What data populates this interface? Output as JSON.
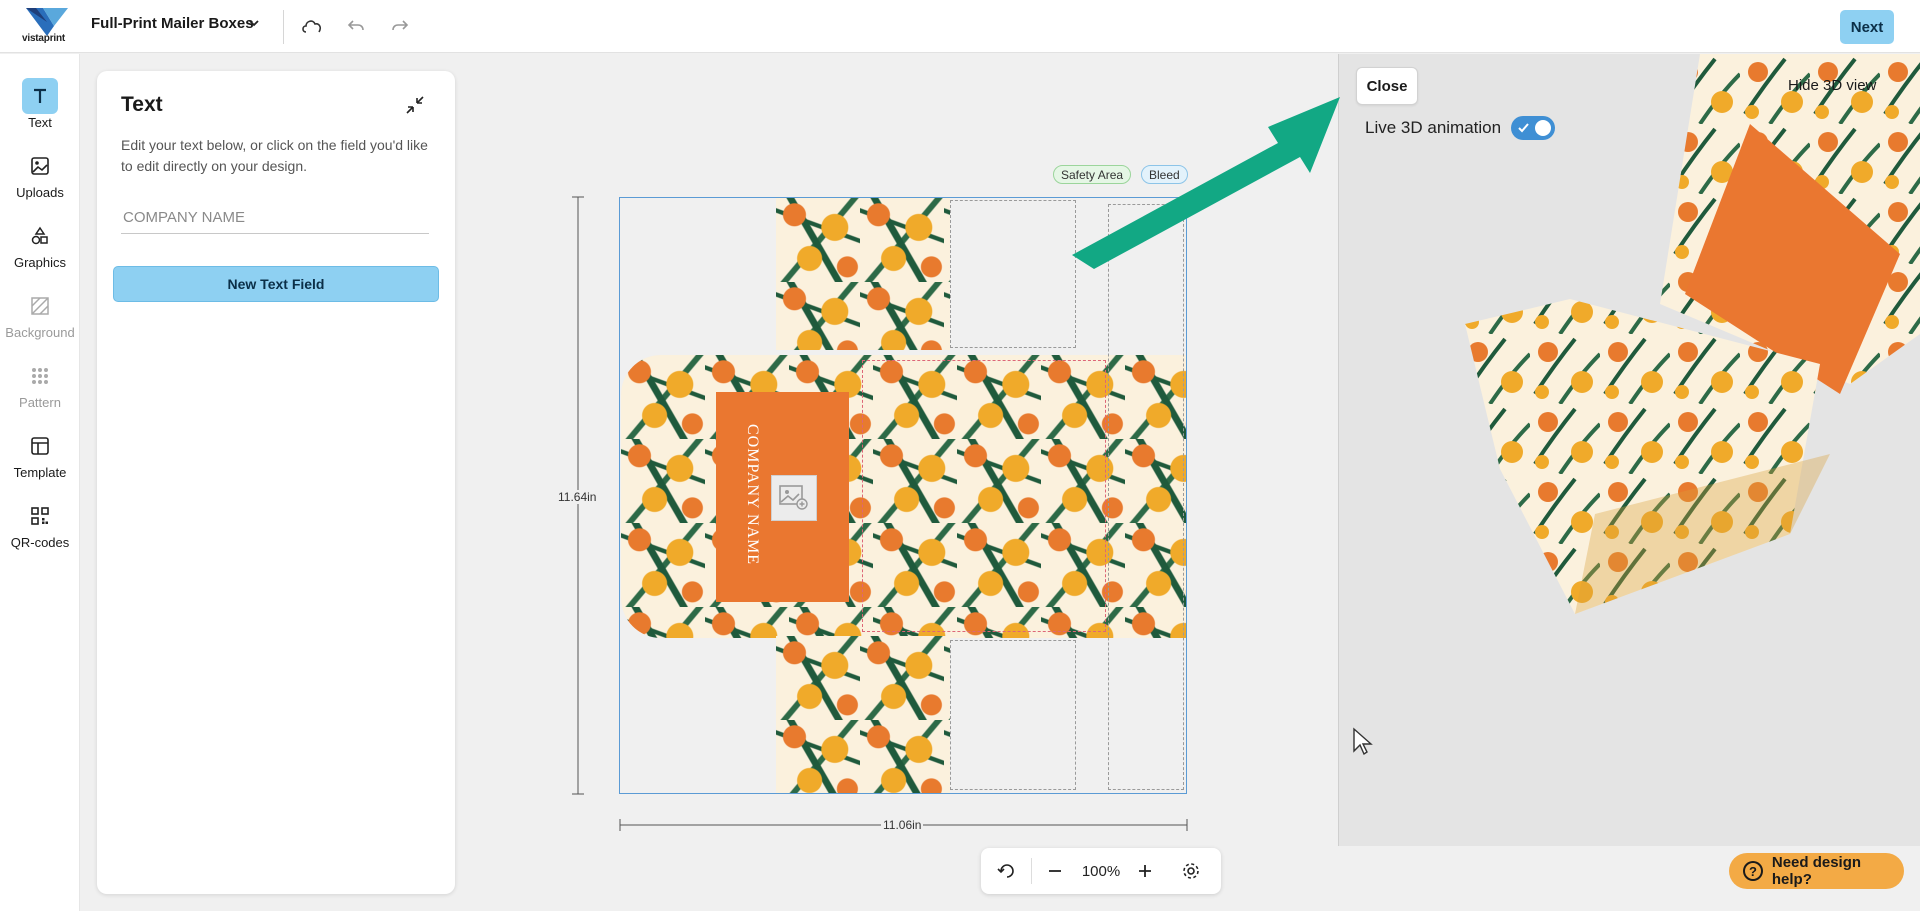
{
  "app": {
    "brand": "vistaprint",
    "product_title": "Full-Print Mailer Boxes",
    "next_label": "Next"
  },
  "rail": {
    "items": [
      {
        "label": "Text",
        "icon": "text-icon",
        "state": "active"
      },
      {
        "label": "Uploads",
        "icon": "image-icon",
        "state": "enabled"
      },
      {
        "label": "Graphics",
        "icon": "shapes-icon",
        "state": "enabled"
      },
      {
        "label": "Background",
        "icon": "background-icon",
        "state": "disabled"
      },
      {
        "label": "Pattern",
        "icon": "pattern-icon",
        "state": "disabled"
      },
      {
        "label": "Template",
        "icon": "template-icon",
        "state": "enabled"
      },
      {
        "label": "QR-codes",
        "icon": "qr-icon",
        "state": "enabled"
      }
    ]
  },
  "text_panel": {
    "title": "Text",
    "description": "Edit your text below, or click on the field you'd like to edit directly on your design.",
    "input_placeholder": "COMPANY NAME",
    "input_value": "",
    "new_field_label": "New Text Field"
  },
  "canvas": {
    "safety_chip": "Safety Area",
    "bleed_chip": "Bleed",
    "height_label": "11.64in",
    "width_label": "11.06in",
    "design_text": "COMPANY NAME",
    "zoom": "100%"
  },
  "view3d": {
    "close_label": "Close",
    "live_label": "Live 3D animation",
    "live_enabled": true,
    "hide_label": "Hide 3D view"
  },
  "help": {
    "label": "Need design help?",
    "icon_glyph": "?"
  },
  "colors": {
    "accent": "#8ed0f2",
    "toggle": "#3f8fd4",
    "help": "#f3aa45",
    "label_panel": "#ea7730",
    "arrow": "#12a884"
  }
}
